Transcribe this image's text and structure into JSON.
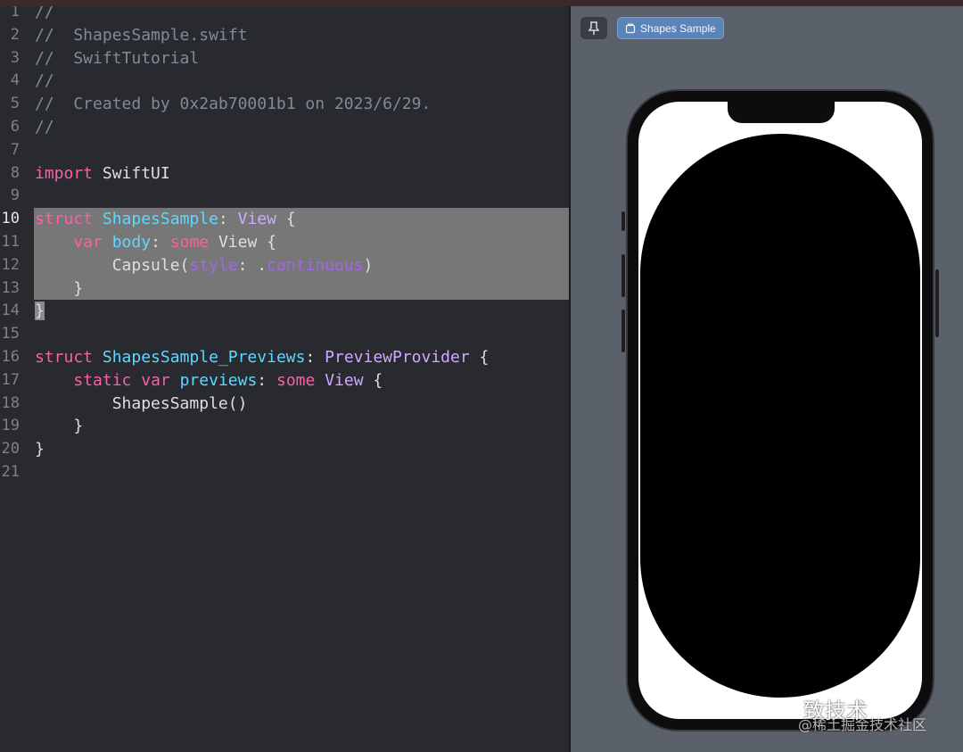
{
  "editor": {
    "lines": [
      {
        "n": "1",
        "tokens": [
          {
            "t": "//",
            "c": "cm"
          }
        ]
      },
      {
        "n": "2",
        "tokens": [
          {
            "t": "//  ShapesSample.swift",
            "c": "cm"
          }
        ]
      },
      {
        "n": "3",
        "tokens": [
          {
            "t": "//  SwiftTutorial",
            "c": "cm"
          }
        ]
      },
      {
        "n": "4",
        "tokens": [
          {
            "t": "//",
            "c": "cm"
          }
        ]
      },
      {
        "n": "5",
        "tokens": [
          {
            "t": "//  Created by 0x2ab70001b1 on 2023/6/29.",
            "c": "cm"
          }
        ]
      },
      {
        "n": "6",
        "tokens": [
          {
            "t": "//",
            "c": "cm"
          }
        ]
      },
      {
        "n": "7",
        "tokens": []
      },
      {
        "n": "8",
        "tokens": [
          {
            "t": "import",
            "c": "kw"
          },
          {
            "t": " SwiftUI",
            "c": "pl"
          }
        ]
      },
      {
        "n": "9",
        "tokens": []
      },
      {
        "n": "10",
        "hl": true,
        "cur": true,
        "tokens": [
          {
            "t": "struct",
            "c": "kw"
          },
          {
            "t": " ",
            "c": "pl"
          },
          {
            "t": "ShapesSample",
            "c": "ty"
          },
          {
            "t": ": ",
            "c": "pl"
          },
          {
            "t": "View",
            "c": "ty2"
          },
          {
            "t": " {",
            "c": "pl"
          }
        ]
      },
      {
        "n": "11",
        "hl": true,
        "tokens": [
          {
            "t": "    ",
            "c": "pl"
          },
          {
            "t": "var",
            "c": "kw"
          },
          {
            "t": " ",
            "c": "pl"
          },
          {
            "t": "body",
            "c": "ty"
          },
          {
            "t": ": ",
            "c": "pl"
          },
          {
            "t": "some",
            "c": "kw"
          },
          {
            "t": " View {",
            "c": "pl"
          }
        ]
      },
      {
        "n": "12",
        "hl": true,
        "tokens": [
          {
            "t": "        Capsule(",
            "c": "pl"
          },
          {
            "t": "style",
            "c": "pr"
          },
          {
            "t": ": .",
            "c": "pl"
          },
          {
            "t": "continuous",
            "c": "pr"
          },
          {
            "t": ")",
            "c": "pl"
          }
        ]
      },
      {
        "n": "13",
        "hl": true,
        "tokens": [
          {
            "t": "    }",
            "c": "pl"
          }
        ]
      },
      {
        "n": "14",
        "cursorbox": true,
        "tokens": [
          {
            "t": "}",
            "c": "pl"
          }
        ]
      },
      {
        "n": "15",
        "tokens": []
      },
      {
        "n": "16",
        "tokens": [
          {
            "t": "struct",
            "c": "kw"
          },
          {
            "t": " ",
            "c": "pl"
          },
          {
            "t": "ShapesSample_Previews",
            "c": "ty"
          },
          {
            "t": ": ",
            "c": "pl"
          },
          {
            "t": "PreviewProvider",
            "c": "ty2"
          },
          {
            "t": " {",
            "c": "pl"
          }
        ]
      },
      {
        "n": "17",
        "tokens": [
          {
            "t": "    ",
            "c": "pl"
          },
          {
            "t": "static",
            "c": "kw"
          },
          {
            "t": " ",
            "c": "pl"
          },
          {
            "t": "var",
            "c": "kw"
          },
          {
            "t": " ",
            "c": "pl"
          },
          {
            "t": "previews",
            "c": "ty"
          },
          {
            "t": ": ",
            "c": "pl"
          },
          {
            "t": "some",
            "c": "kw"
          },
          {
            "t": " ",
            "c": "pl"
          },
          {
            "t": "View",
            "c": "ty2"
          },
          {
            "t": " {",
            "c": "pl"
          }
        ]
      },
      {
        "n": "18",
        "tokens": [
          {
            "t": "        ShapesSample()",
            "c": "pl"
          }
        ]
      },
      {
        "n": "19",
        "tokens": [
          {
            "t": "    }",
            "c": "pl"
          }
        ]
      },
      {
        "n": "20",
        "tokens": [
          {
            "t": "}",
            "c": "pl"
          }
        ]
      },
      {
        "n": "21",
        "tokens": []
      }
    ]
  },
  "preview": {
    "pin_icon": "pin-icon",
    "chip_icon": "device-icon",
    "chip_label": "Shapes Sample"
  },
  "watermark": {
    "main": "致技术",
    "sub": "@稀土掘金技术社区"
  },
  "colors": {
    "keyword": "#fc5fa3",
    "type": "#5dd8ff",
    "comment": "#7f8c98",
    "selection": "#777777",
    "canvas": "#5b616a",
    "chip": "#5d84b8"
  }
}
